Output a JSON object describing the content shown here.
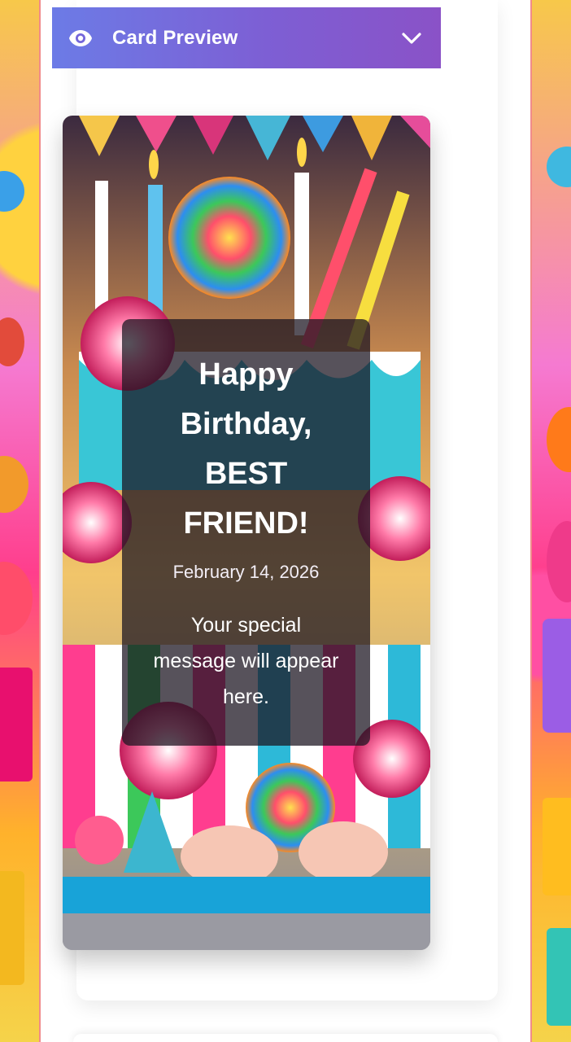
{
  "preview": {
    "header_label": "Card Preview",
    "header_icon": "eye-icon",
    "toggle_icon": "chevron-down-icon",
    "accent_start": "#6c7be6",
    "accent_end": "#8a52c7"
  },
  "card": {
    "background": "candy-birthday-cake-illustration",
    "greeting": "Happy Birthday, BEST FRIEND!",
    "date": "February 14, 2026",
    "message": "Your special message will appear here."
  }
}
